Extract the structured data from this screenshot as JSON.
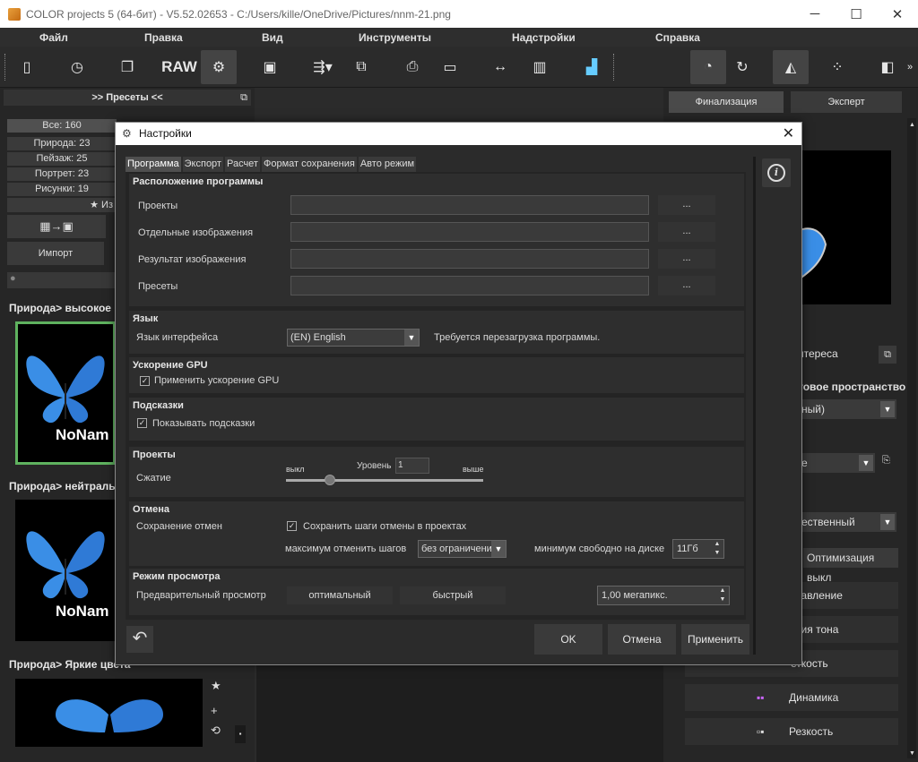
{
  "window": {
    "title": "COLOR projects 5 (64-бит) - V5.52.02653 - C:/Users/kille/OneDrive/Pictures/nnm-21.png",
    "minimize": "─",
    "maximize": "☐",
    "close": "✕"
  },
  "menu": [
    "Файл",
    "Правка",
    "Вид",
    "Инструменты",
    "Надстройки",
    "Справка"
  ],
  "toolbar": {
    "raw_label": "RAW"
  },
  "left_panel": {
    "header": ">> Пресеты <<",
    "categories": [
      "Все: 160",
      "Природа: 23",
      "Пейзаж: 25",
      "Портрет: 23",
      "Рисунки: 19"
    ],
    "favorites_label": "Из",
    "import_label": "Импорт",
    "presets": [
      "Природа> высокое",
      "Природа> нейтраль",
      "Природа> Яркие цвета"
    ],
    "watermark": "NoNam"
  },
  "right_panel": {
    "tabs": [
      "Финализация",
      "Эксперт"
    ],
    "interest_label": "нтереса",
    "color_space_label": "товое пространство",
    "combo1": "ный)",
    "combo2": "е",
    "combo3": "ественный",
    "optimization": "Оптимизация выкл",
    "rows": [
      "одавление",
      "ация тона",
      "еткость",
      "Динамика",
      "Резкость"
    ]
  },
  "dialog": {
    "title": "Настройки",
    "tabs": [
      "Программа",
      "Экспорт",
      "Расчет",
      "Формат сохранения",
      "Авто режим"
    ],
    "location": {
      "title": "Расположение программы",
      "rows": [
        "Проекты",
        "Отдельные изображения",
        "Результат изображения",
        "Пресеты"
      ],
      "browse": "..."
    },
    "language": {
      "title": "Язык",
      "label": "Язык интерфейса",
      "value": "(EN) English",
      "note": "Требуется перезагрузка программы."
    },
    "gpu": {
      "title": "Ускорение GPU",
      "checkbox": "Применить ускорение GPU",
      "checked": true
    },
    "hints": {
      "title": "Подсказки",
      "checkbox": "Показывать подсказки",
      "checked": true
    },
    "projects": {
      "title": "Проекты",
      "compression": "Сжатие",
      "off": "выкл",
      "level_label": "Уровень",
      "level_value": "1",
      "high": "выше"
    },
    "undo": {
      "title": "Отмена",
      "label": "Сохранение отмен",
      "checkbox": "Сохранить шаги отмены в проектах",
      "checked": true,
      "max_steps_label": "максимум отменить шагов",
      "max_steps_value": "без ограничени",
      "min_free_label": "минимум свободно на диске",
      "min_free_value": "11Гб"
    },
    "view_mode": {
      "title": "Режим просмотра",
      "label": "Предварительный просмотр",
      "option1": "оптимальный",
      "option2": "быстрый",
      "megapixels": "1,00 мегапикс."
    },
    "buttons": {
      "ok": "OK",
      "cancel": "Отмена",
      "apply": "Применить"
    }
  }
}
